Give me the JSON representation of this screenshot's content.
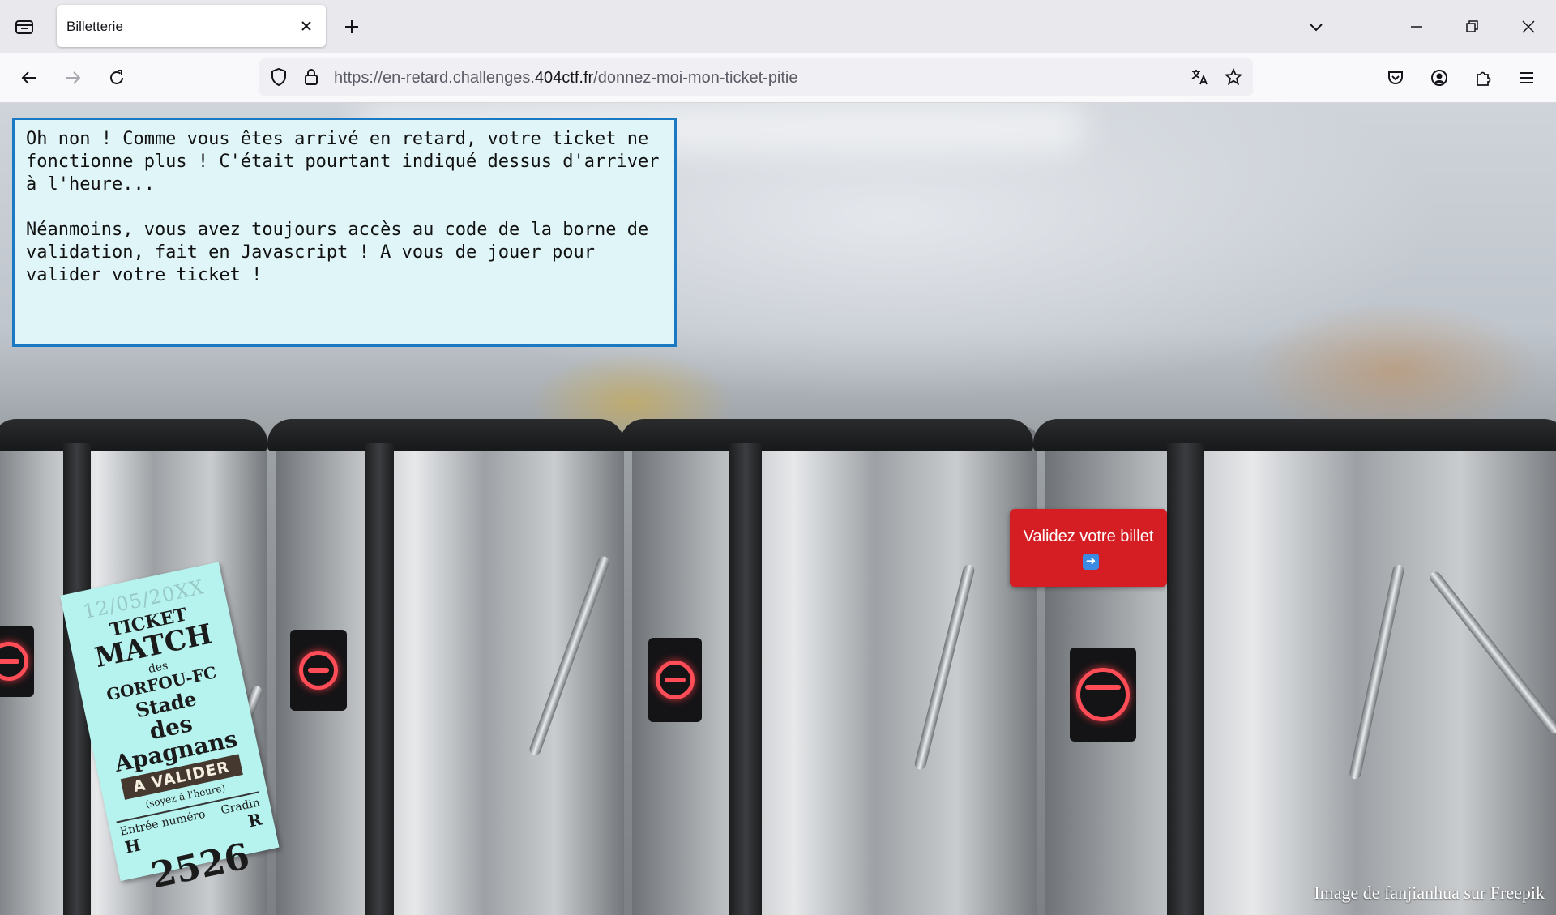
{
  "browser": {
    "tab_title": "Billetterie",
    "url_prefix": "https://en-retard.challenges.",
    "url_domain": "404ctf.fr",
    "url_path": "/donnez-moi-mon-ticket-pitie"
  },
  "icons": {
    "tab_list": "tab-list-icon",
    "tab_close": "close-icon",
    "new_tab": "plus-icon",
    "list_all_tabs": "chevron-down-icon",
    "minimize": "minimize-icon",
    "restore": "restore-icon",
    "close_window": "close-icon",
    "back": "arrow-left-icon",
    "forward": "arrow-right-icon",
    "reload": "reload-icon",
    "tracking_protection": "shield-icon",
    "secure": "lock-icon",
    "translate": "translate-icon",
    "bookmark": "star-icon",
    "pocket": "pocket-icon",
    "account": "account-icon",
    "extensions": "puzzle-icon",
    "menu": "hamburger-icon"
  },
  "page": {
    "message_paragraph_1": "Oh non ! Comme vous êtes arrivé en retard, votre ticket ne fonctionne plus ! C'était pourtant indiqué dessus d'arriver à l'heure...",
    "message_paragraph_2": "Néanmoins, vous avez toujours accès au code de la borne de validation, fait en Javascript ! A vous de jouer pour valider votre ticket !",
    "validate_button_label": "Validez votre billet",
    "validate_button_emoji": "➡️",
    "credit": "Image de fanjianhua sur Freepik",
    "colors": {
      "message_bg": "#dff5f7",
      "message_border": "#1a79c2",
      "button_bg": "#d41e24",
      "ticket_bg": "#b6f3ee"
    }
  },
  "ticket": {
    "date": "12/05/20XX",
    "ticket": "TICKET",
    "match": "MATCH",
    "des": "des",
    "club": "GORFOU-FC",
    "stade": "Stade",
    "apagnans": "des Apagnans",
    "a_valider": "A VALIDER",
    "soyez": "(soyez à l'heure)",
    "entree_label": "Entrée numéro",
    "gradin_label": "Gradin",
    "entree_letter": "H",
    "gradin_letter": "R",
    "number": "2526"
  }
}
